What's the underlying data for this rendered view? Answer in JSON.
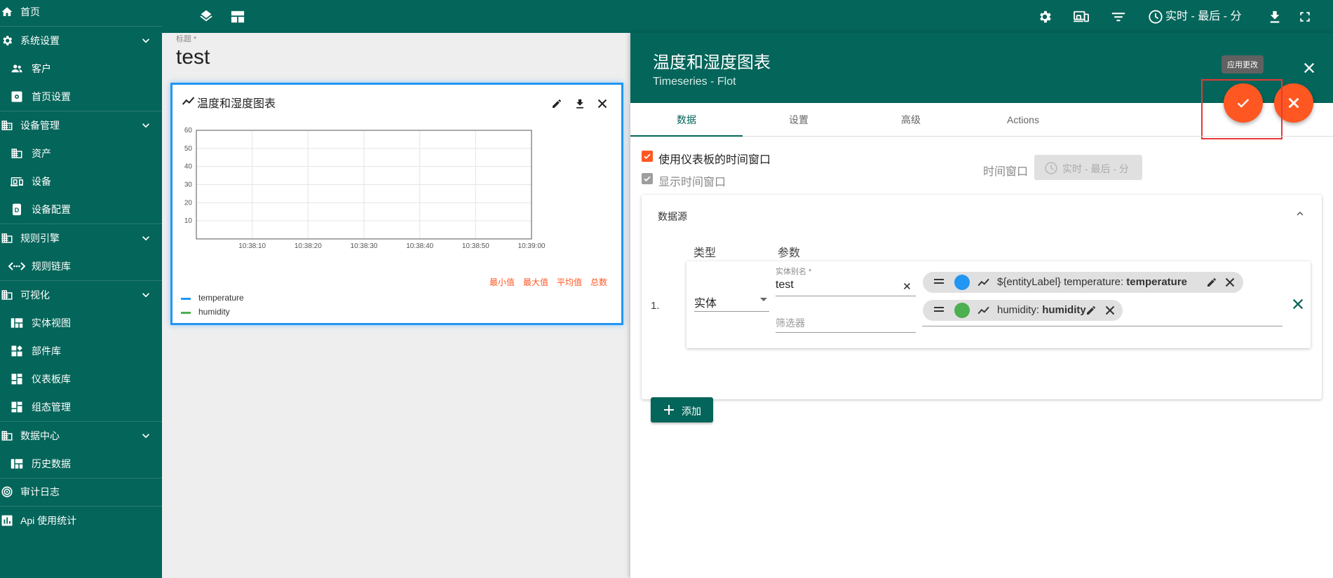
{
  "sidebar": {
    "items": [
      {
        "label": "首页"
      },
      {
        "label": "系统设置"
      },
      {
        "label": "客户"
      },
      {
        "label": "首页设置"
      },
      {
        "label": "设备管理"
      },
      {
        "label": "资产"
      },
      {
        "label": "设备"
      },
      {
        "label": "设备配置"
      },
      {
        "label": "规则引擎"
      },
      {
        "label": "规则链库"
      },
      {
        "label": "可视化"
      },
      {
        "label": "实体视图"
      },
      {
        "label": "部件库"
      },
      {
        "label": "仪表板库"
      },
      {
        "label": "组态管理"
      },
      {
        "label": "数据中心"
      },
      {
        "label": "历史数据"
      },
      {
        "label": "审计日志"
      },
      {
        "label": "Api 使用统计"
      }
    ]
  },
  "topbar": {
    "time_label": "实时 - 最后 - 分"
  },
  "dashboard": {
    "title_label": "标题 *",
    "title_value": "test",
    "widget": {
      "title": "温度和湿度图表",
      "stats": [
        "最小值",
        "最大值",
        "平均值",
        "总数"
      ],
      "legend": [
        {
          "name": "temperature",
          "color": "#2196f3"
        },
        {
          "name": "humidity",
          "color": "#4caf50"
        }
      ]
    }
  },
  "chart_data": {
    "type": "line",
    "title": "温度和湿度图表",
    "xlabel": "",
    "ylabel": "",
    "x_ticks": [
      "10:38:10",
      "10:38:20",
      "10:38:30",
      "10:38:40",
      "10:38:50",
      "10:39:00"
    ],
    "y_ticks": [
      10,
      20,
      30,
      40,
      50,
      60
    ],
    "ylim": [
      0,
      60
    ],
    "grid": true,
    "series": [
      {
        "name": "temperature",
        "color": "#2196f3",
        "values": []
      },
      {
        "name": "humidity",
        "color": "#4caf50",
        "values": []
      }
    ]
  },
  "panel": {
    "title": "温度和湿度图表",
    "subtitle": "Timeseries - Flot",
    "tooltip": "应用更改",
    "tabs": [
      {
        "label": "数据"
      },
      {
        "label": "设置"
      },
      {
        "label": "高级"
      },
      {
        "label": "Actions"
      }
    ],
    "use_dashboard_timewindow": "使用仪表板的时间窗口",
    "show_timewindow": "显示时间窗口",
    "timewindow_label": "时间窗口",
    "timewindow_value": "实时 - 最后 - 分",
    "datasource": {
      "section_title": "数据源",
      "col_type": "类型",
      "col_params": "参数",
      "row_index": "1.",
      "type_value": "实体",
      "alias_label": "实体别名 *",
      "alias_value": "test",
      "filter_placeholder": "筛选器",
      "keys": [
        {
          "prefix": "${entityLabel} temperature: ",
          "key": "temperature",
          "color": "#2196f3"
        },
        {
          "prefix": "humidity: ",
          "key": "humidity",
          "color": "#4caf50"
        }
      ],
      "add_label": "添加"
    }
  },
  "colors": {
    "primary": "#04655a",
    "accent": "#ff5722",
    "highlight": "#e53935"
  }
}
